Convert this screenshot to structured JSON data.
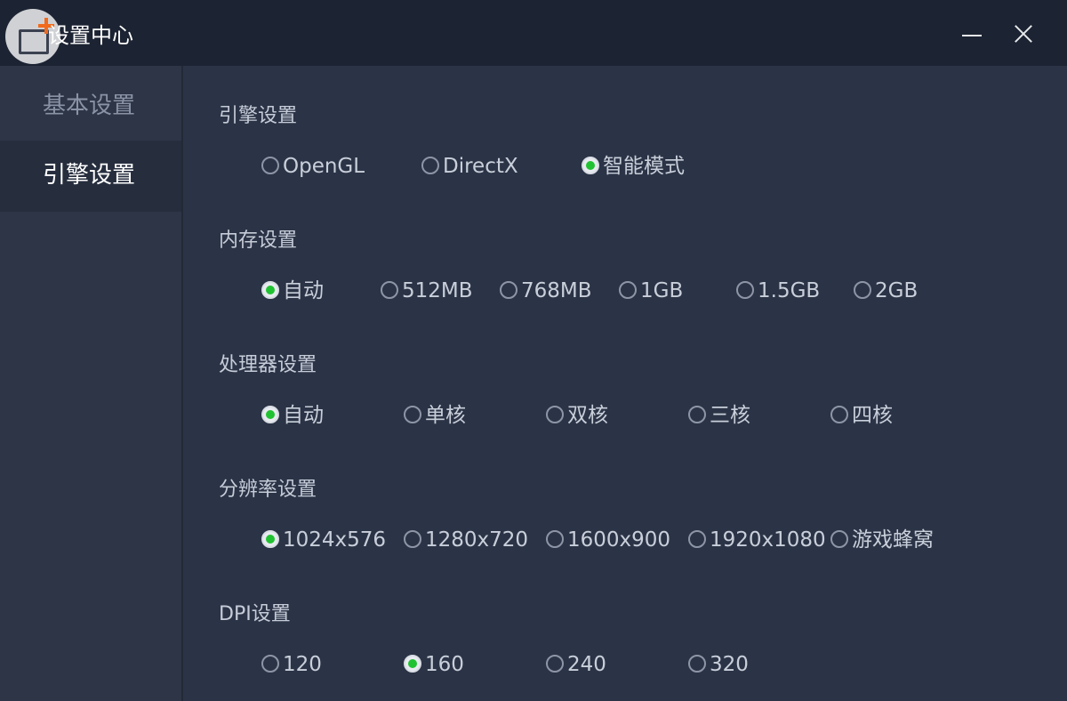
{
  "window": {
    "title": "设置中心"
  },
  "sidebar": {
    "items": [
      {
        "label": "基本设置",
        "selected": false
      },
      {
        "label": "引擎设置",
        "selected": true
      }
    ]
  },
  "engine": {
    "title": "引擎设置",
    "options": [
      "OpenGL",
      "DirectX",
      "智能模式"
    ],
    "selected": "智能模式"
  },
  "memory": {
    "title": "内存设置",
    "options": [
      "自动",
      "512MB",
      "768MB",
      "1GB",
      "1.5GB",
      "2GB"
    ],
    "selected": "自动"
  },
  "cpu": {
    "title": "处理器设置",
    "options": [
      "自动",
      "单核",
      "双核",
      "三核",
      "四核"
    ],
    "selected": "自动"
  },
  "resolution": {
    "title": "分辨率设置",
    "options": [
      "1024x576",
      "1280x720",
      "1600x900",
      "1920x1080",
      "游戏蜂窝"
    ],
    "selected": "1024x576"
  },
  "dpi": {
    "title": "DPI设置",
    "options": [
      "120",
      "160",
      "240",
      "320"
    ],
    "selected": "160"
  },
  "colors": {
    "titlebar_bg": "#1c2332",
    "content_bg": "#2b3446",
    "radio_selected": "#21c232",
    "app_icon_accent": "#f26a1b"
  },
  "icons": {
    "app": "app-logo-icon",
    "minimize": "minimize-icon",
    "close": "close-icon"
  }
}
